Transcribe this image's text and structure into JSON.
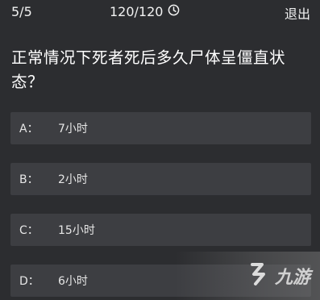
{
  "header": {
    "progress": "5/5",
    "timer": "120/120",
    "exit_label": "退出"
  },
  "question": {
    "text": "正常情况下死者死后多久尸体呈僵直状态？"
  },
  "options": [
    {
      "letter": "A：",
      "text": "7小时"
    },
    {
      "letter": "B：",
      "text": "2小时"
    },
    {
      "letter": "C：",
      "text": "15小时"
    },
    {
      "letter": "D：",
      "text": "6小时"
    }
  ],
  "watermark": {
    "text": "九游"
  },
  "colors": {
    "background": "#2c2d30",
    "option_bg": "#3d3e42",
    "text": "#ffffff"
  }
}
